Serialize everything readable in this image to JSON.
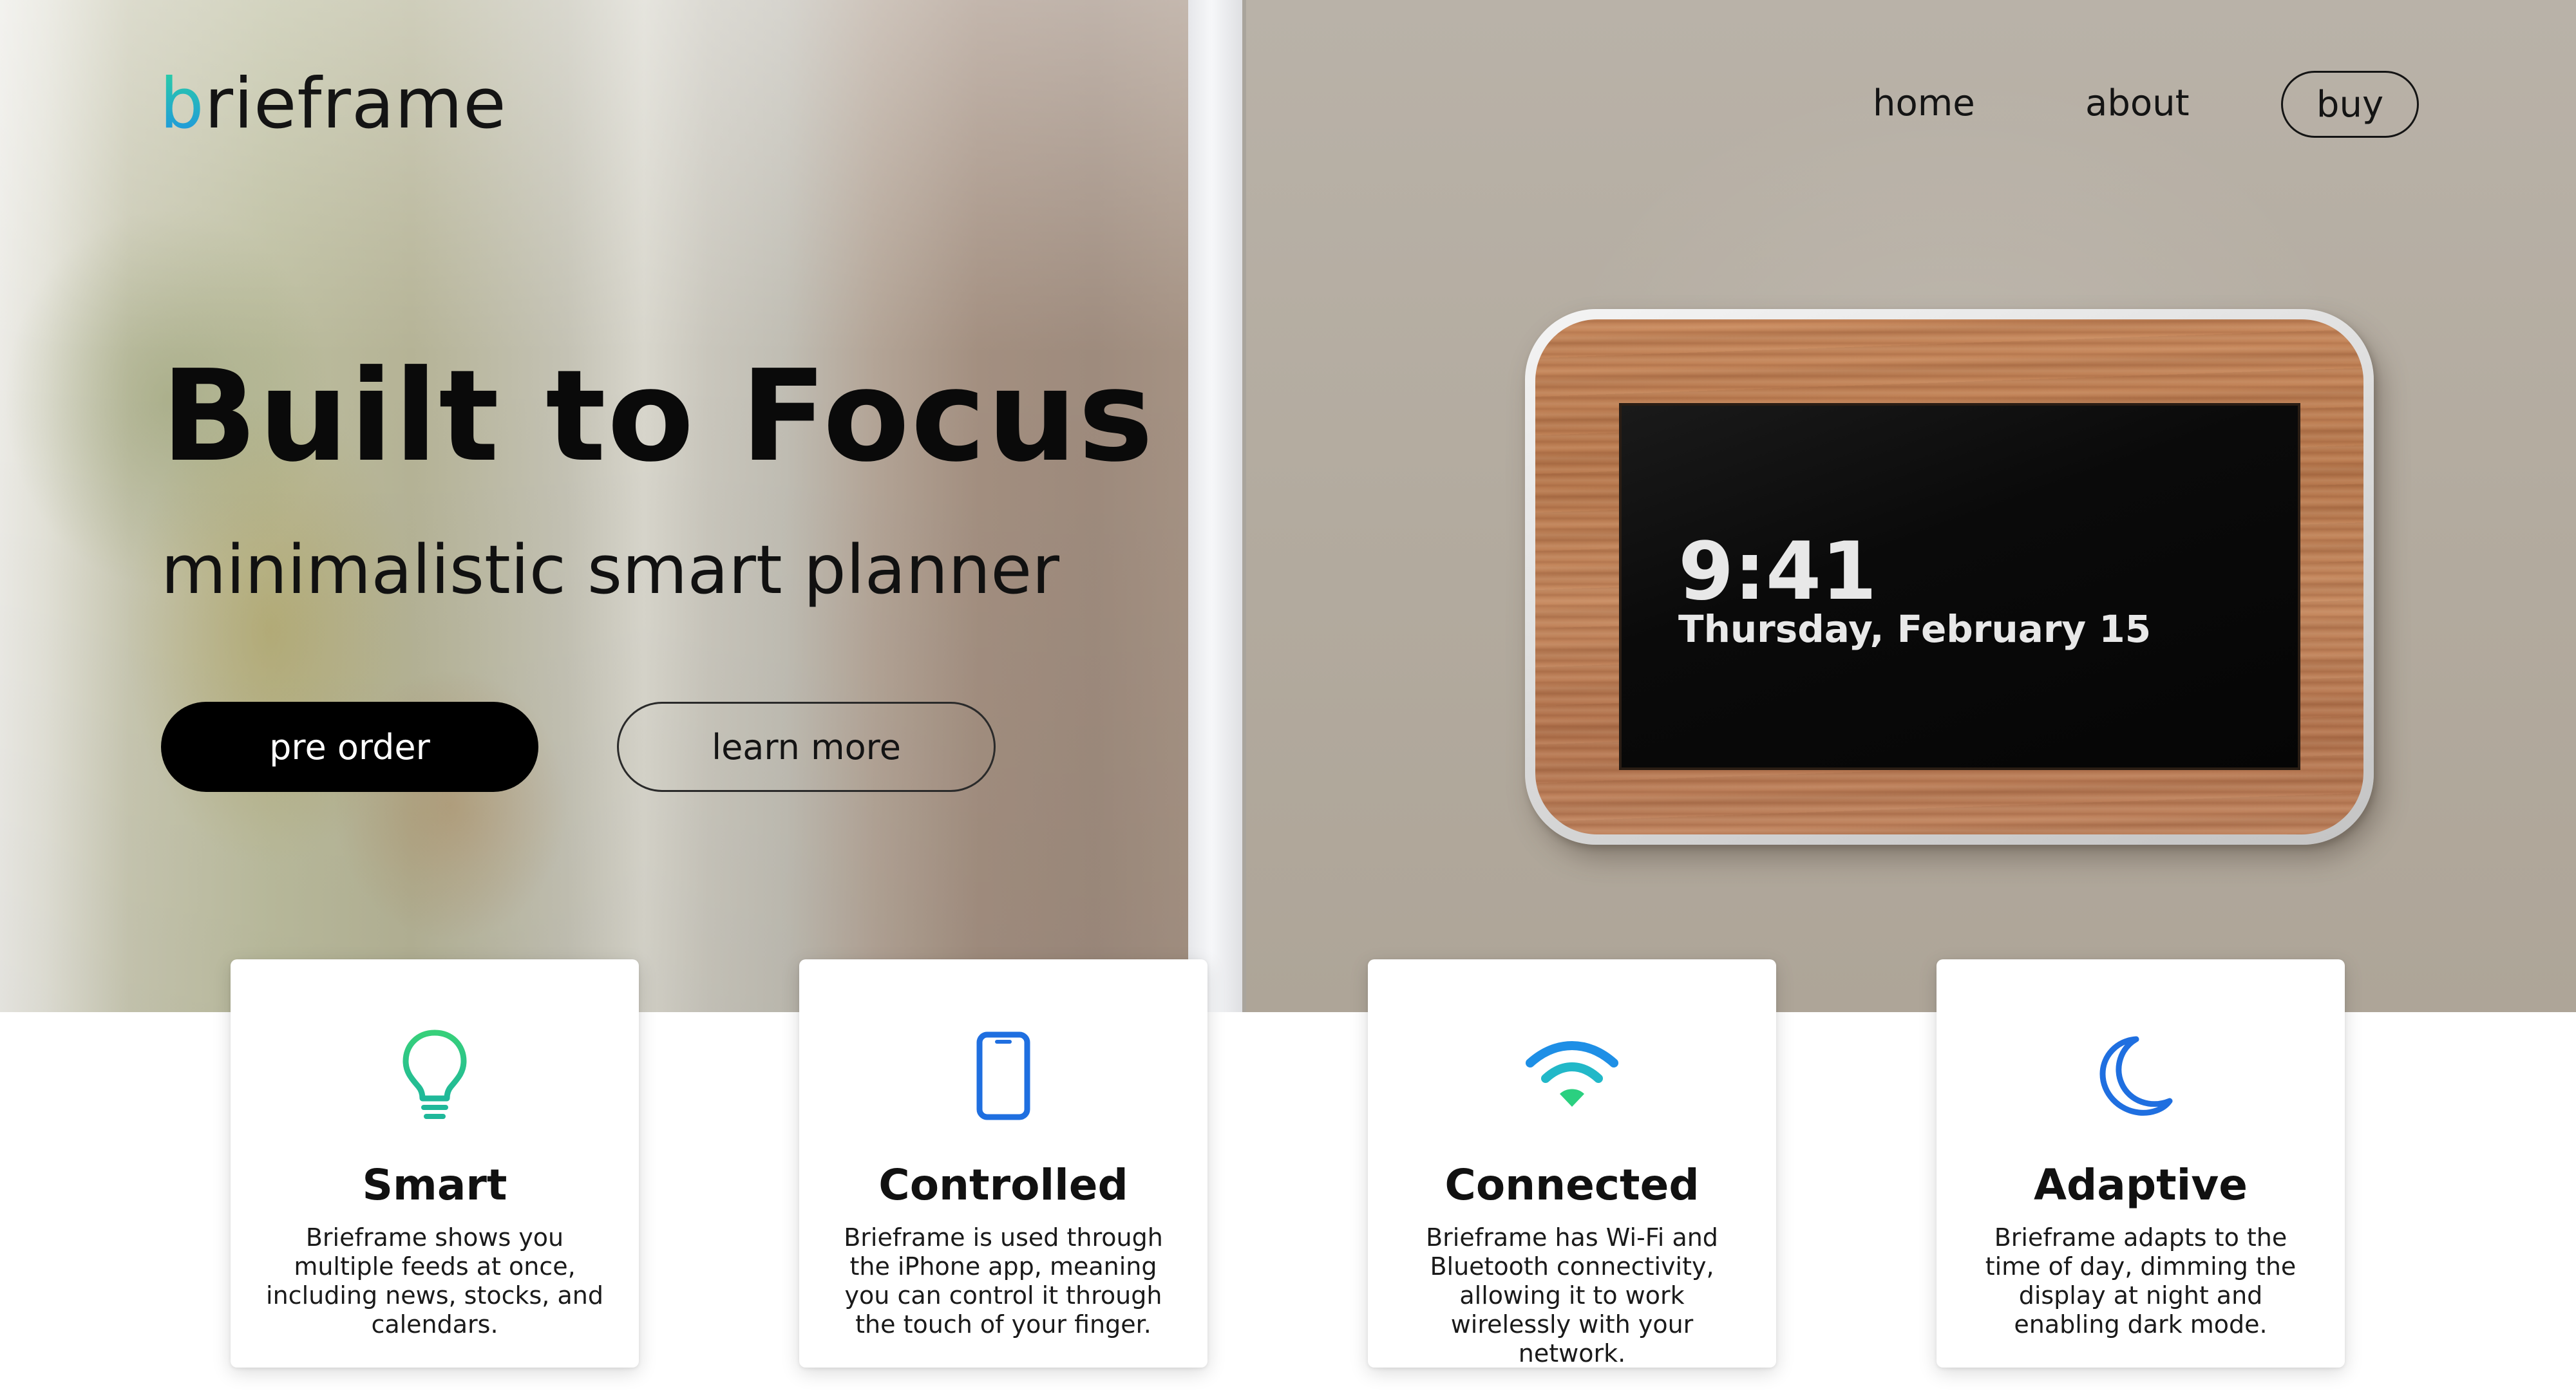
{
  "brand": {
    "logo_first_letter": "b",
    "logo_rest": "rieframe",
    "accent_gradient": [
      "#2bd3a0",
      "#1e8fe6"
    ]
  },
  "nav": {
    "home": "home",
    "about": "about",
    "buy": "buy"
  },
  "hero": {
    "title": "Built to Focus",
    "subtitle": "minimalistic smart planner",
    "primary_button": "pre order",
    "secondary_button": "learn more"
  },
  "device": {
    "time": "9:41",
    "date": "Thursday, February 15"
  },
  "features": [
    {
      "icon": "lightbulb-icon",
      "color": "#2bc48a",
      "title": "Smart",
      "text": "Brieframe shows you multiple feeds at once, including news, stocks, and calendars."
    },
    {
      "icon": "phone-icon",
      "color": "#1f6fe0",
      "title": "Controlled",
      "text": "Brieframe is used through the iPhone app, meaning you can control it through the touch of your finger."
    },
    {
      "icon": "wifi-icon",
      "color": "#22a8e0",
      "title": "Connected",
      "text": "Brieframe has Wi-Fi and Bluetooth connectivity, allowing it to work wirelessly with your network."
    },
    {
      "icon": "moon-icon",
      "color": "#1f6fe0",
      "title": "Adaptive",
      "text": "Brieframe adapts to the time of day, dimming the display at night and enabling dark mode."
    }
  ]
}
